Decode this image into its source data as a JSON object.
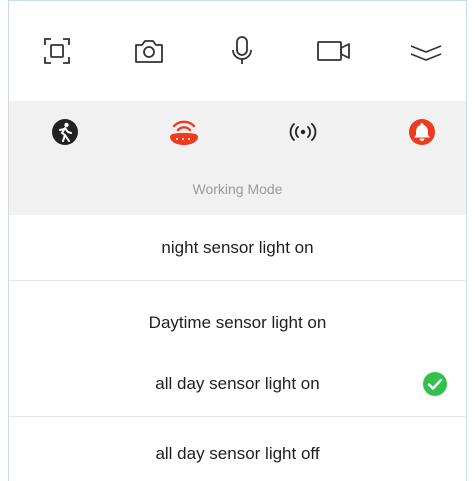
{
  "toolbar": {
    "icons": [
      "screenshot-icon",
      "camera-icon",
      "microphone-icon",
      "video-icon",
      "collapse-icon"
    ]
  },
  "modes": {
    "icons": [
      "pedestrian-icon",
      "sensor-light-icon",
      "radar-signal-icon",
      "alarm-bell-icon"
    ],
    "active_color": "#ee3b1f",
    "inactive_color": "#222222"
  },
  "working_mode": {
    "header": "Working Mode",
    "options": [
      {
        "label": "night sensor light on",
        "selected": false
      },
      {
        "label": "Daytime sensor light on",
        "selected": false
      },
      {
        "label": "all day sensor light on",
        "selected": true
      },
      {
        "label": "all day sensor light off",
        "selected": false
      }
    ],
    "check_color": "#33c04d"
  }
}
